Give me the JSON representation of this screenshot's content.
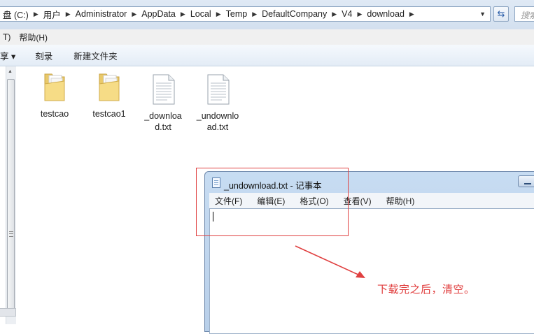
{
  "address": {
    "crumbs": [
      "盘 (C:)",
      "用户",
      "Administrator",
      "AppData",
      "Local",
      "Temp",
      "DefaultCompany",
      "V4",
      "download"
    ],
    "search_placeholder": "搜索"
  },
  "menubar": {
    "items": [
      "T)",
      "帮助(H)"
    ]
  },
  "toolbar": {
    "items": [
      "享 ▾",
      "刻录",
      "新建文件夹"
    ]
  },
  "files": [
    {
      "name": "testcao",
      "type": "folder"
    },
    {
      "name": "testcao1",
      "type": "folder"
    },
    {
      "name": "_download.txt",
      "type": "text"
    },
    {
      "name": "_undownload.txt",
      "type": "text"
    }
  ],
  "notepad": {
    "title": "_undownload.txt - 记事本",
    "menu": [
      "文件(F)",
      "编辑(E)",
      "格式(O)",
      "查看(V)",
      "帮助(H)"
    ],
    "content": ""
  },
  "annotation": {
    "note": "下载完之后，清空。",
    "color": "#e03c3c"
  }
}
